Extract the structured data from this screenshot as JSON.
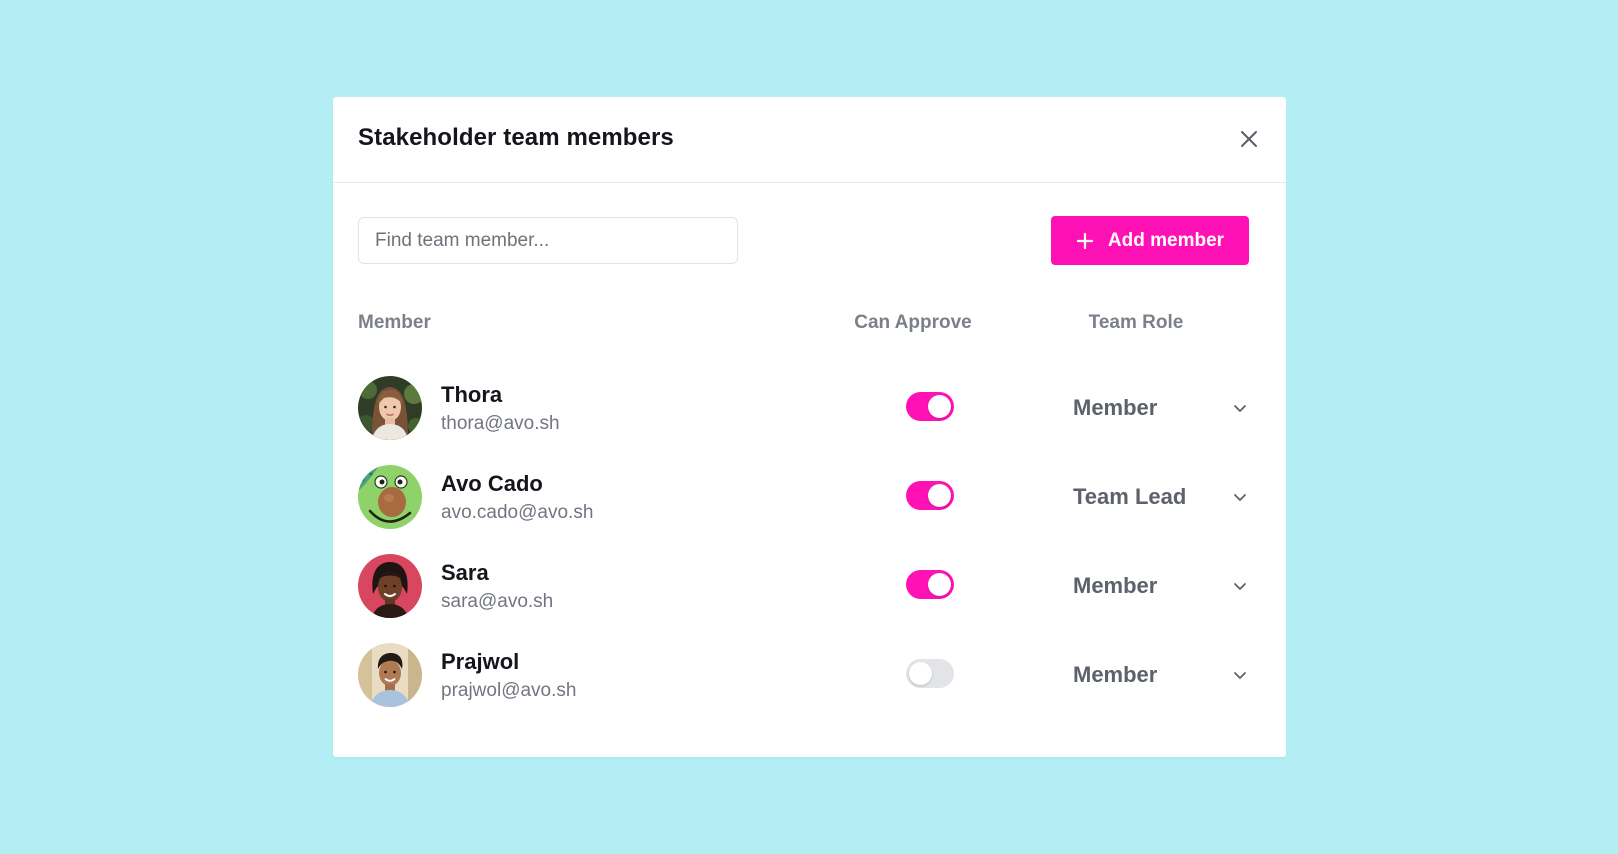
{
  "colors": {
    "background": "#b3eef5",
    "accent": "#ff12b5",
    "toggle_off": "#e3e4e8"
  },
  "modal": {
    "title": "Stakeholder team members",
    "close_icon": "close-icon"
  },
  "search": {
    "placeholder": "Find team member...",
    "value": ""
  },
  "add_button": {
    "label": "Add member",
    "icon": "plus-icon"
  },
  "columns": {
    "member": "Member",
    "can_approve": "Can Approve",
    "team_role": "Team Role"
  },
  "members": [
    {
      "name": "Thora",
      "email": "thora@avo.sh",
      "can_approve": true,
      "role": "Member",
      "avatar": "avatar-photo-woman-long-hair"
    },
    {
      "name": "Avo Cado",
      "email": "avo.cado@avo.sh",
      "can_approve": true,
      "role": "Team Lead",
      "avatar": "avocado-icon"
    },
    {
      "name": "Sara",
      "email": "sara@avo.sh",
      "can_approve": true,
      "role": "Member",
      "avatar": "avatar-photo-woman-pink-background"
    },
    {
      "name": "Prajwol",
      "email": "prajwol@avo.sh",
      "can_approve": false,
      "role": "Member",
      "avatar": "avatar-photo-man"
    }
  ]
}
